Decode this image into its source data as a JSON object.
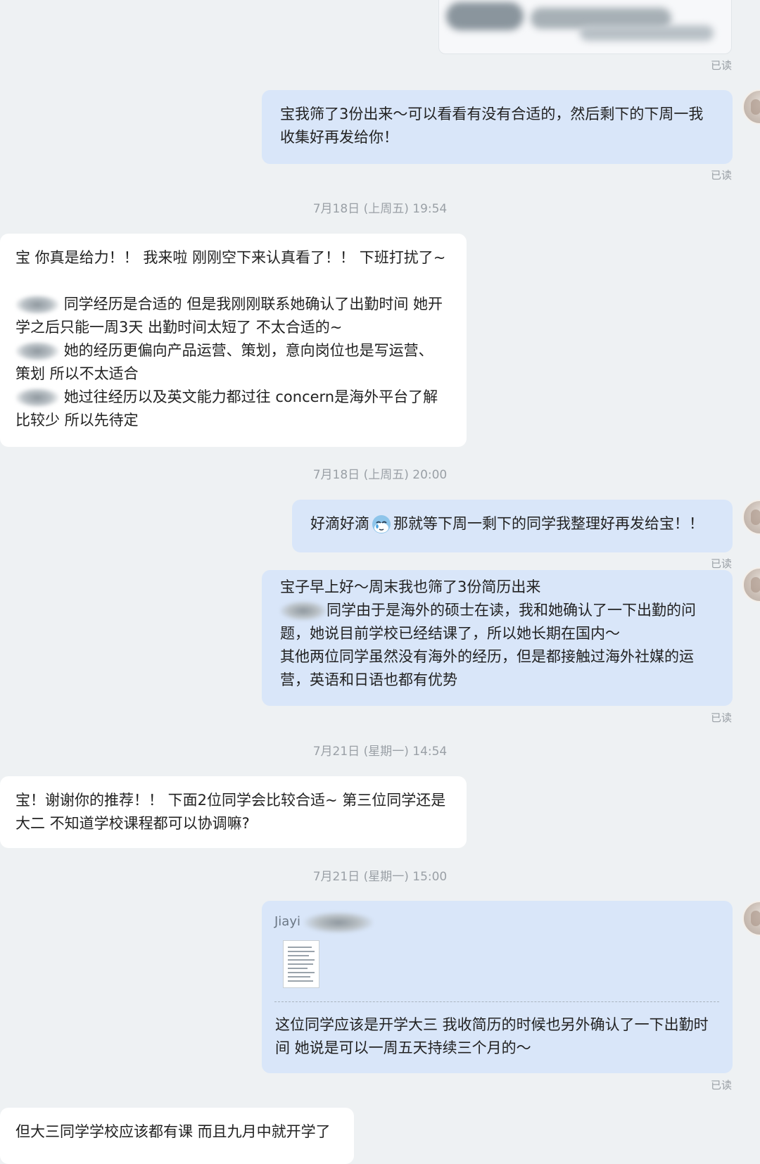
{
  "read_label": "已读",
  "messages": {
    "m1": {
      "lines": [
        "宝我筛了3份出来～可以看看有没有合适的，然后剩下的下周一我",
        "收集好再发给你！"
      ]
    },
    "ts1": "7月18日 (上周五) 19:54",
    "m2": {
      "l1": "宝  你真是给力！！  我来啦 刚刚空下来认真看了！！ 下班打扰了~",
      "l2": "同学经历是合适的 但是我刚刚联系她确认了出勤时间 她开",
      "l3": "学之后只能一周3天 出勤时间太短了 不太合适的~",
      "l4": "她的经历更偏向产品运营、策划，意向岗位也是写运营、",
      "l5": "策划  所以不太适合",
      "l6": "她过往经历以及英文能力都过往 concern是海外平台了解",
      "l7": "比较少 所以先待定"
    },
    "ts2": "7月18日 (上周五) 20:00",
    "m3": {
      "before": "好滴好滴",
      "after": "那就等下周一剩下的同学我整理好再发给宝！！"
    },
    "m4": {
      "l1": "宝子早上好～周末我也筛了3份简历出来",
      "l2": "同学由于是海外的硕士在读，我和她确认了一下出勤的问",
      "l3": "题，她说目前学校已经结课了，所以她长期在国内～",
      "l4": "其他两位同学虽然没有海外的经历，但是都接触过海外社媒的运",
      "l5": "营，英语和日语也都有优势"
    },
    "ts3": "7月21日 (星期一) 14:54",
    "m5": {
      "lines": [
        "宝！谢谢你的推荐！！ 下面2位同学会比较合适~ 第三位同学还是",
        "大二 不知道学校课程都可以协调嘛?"
      ]
    },
    "ts4": "7月21日 (星期一) 15:00",
    "m6": {
      "sender": "Jiayi",
      "lines": [
        "这位同学应该是开学大三 我收简历的时候也另外确认了一下出勤时",
        "间 她说是可以一周五天持续三个月的～"
      ]
    },
    "m7": {
      "lines": [
        "但大三同学学校应该都有课 而且九月中就开学了"
      ]
    }
  }
}
